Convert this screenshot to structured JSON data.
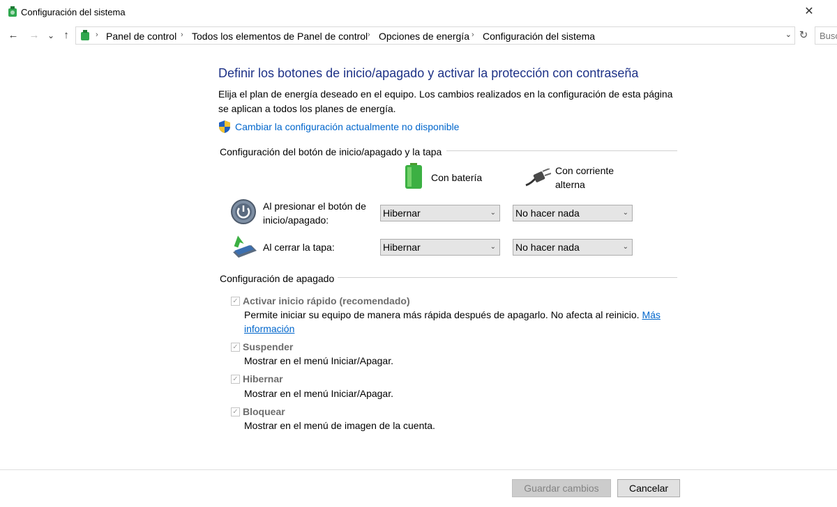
{
  "window": {
    "title": "Configuración del sistema"
  },
  "address_bar": {
    "breadcrumbs": [
      "Panel de control",
      "Todos los elementos de Panel de control",
      "Opciones de energía",
      "Configuración del sistema"
    ],
    "search_placeholder": "Buscar"
  },
  "page": {
    "heading": "Definir los botones de inicio/apagado y activar la protección con contraseña",
    "description": "Elija el plan de energía deseado en el equipo. Los cambios realizados en la configuración de esta página se aplican a todos los planes de energía.",
    "uac_link": "Cambiar la configuración actualmente no disponible"
  },
  "power_buttons": {
    "section_title": "Configuración del botón de inicio/apagado y la tapa",
    "col_battery": "Con batería",
    "col_ac": "Con corriente alterna",
    "rows": [
      {
        "label": "Al presionar el botón de inicio/apagado:",
        "battery": "Hibernar",
        "ac": "No hacer nada"
      },
      {
        "label": "Al cerrar la tapa:",
        "battery": "Hibernar",
        "ac": "No hacer nada"
      }
    ]
  },
  "shutdown": {
    "section_title": "Configuración de apagado",
    "items": [
      {
        "label": "Activar inicio rápido (recomendado)",
        "desc": "Permite iniciar su equipo de manera más rápida después de apagarlo. No afecta al reinicio.",
        "link": "Más información",
        "checked": true
      },
      {
        "label": "Suspender",
        "desc": "Mostrar en el menú Iniciar/Apagar.",
        "checked": true
      },
      {
        "label": "Hibernar",
        "desc": "Mostrar en el menú Iniciar/Apagar.",
        "checked": true
      },
      {
        "label": "Bloquear",
        "desc": "Mostrar en el menú de imagen de la cuenta.",
        "checked": true
      }
    ]
  },
  "footer": {
    "save_label": "Guardar cambios",
    "cancel_label": "Cancelar"
  },
  "glyphs": {
    "close": "✕",
    "back": "←",
    "forward": "→",
    "recent": "⌄",
    "up": "↑",
    "sep": "›",
    "dropdown": "⌄",
    "refresh": "↻",
    "caret": "⌄",
    "check": "✓"
  },
  "colors": {
    "heading": "#1e3287",
    "link": "#0066cc",
    "disabled_text": "#6d6d6d"
  }
}
